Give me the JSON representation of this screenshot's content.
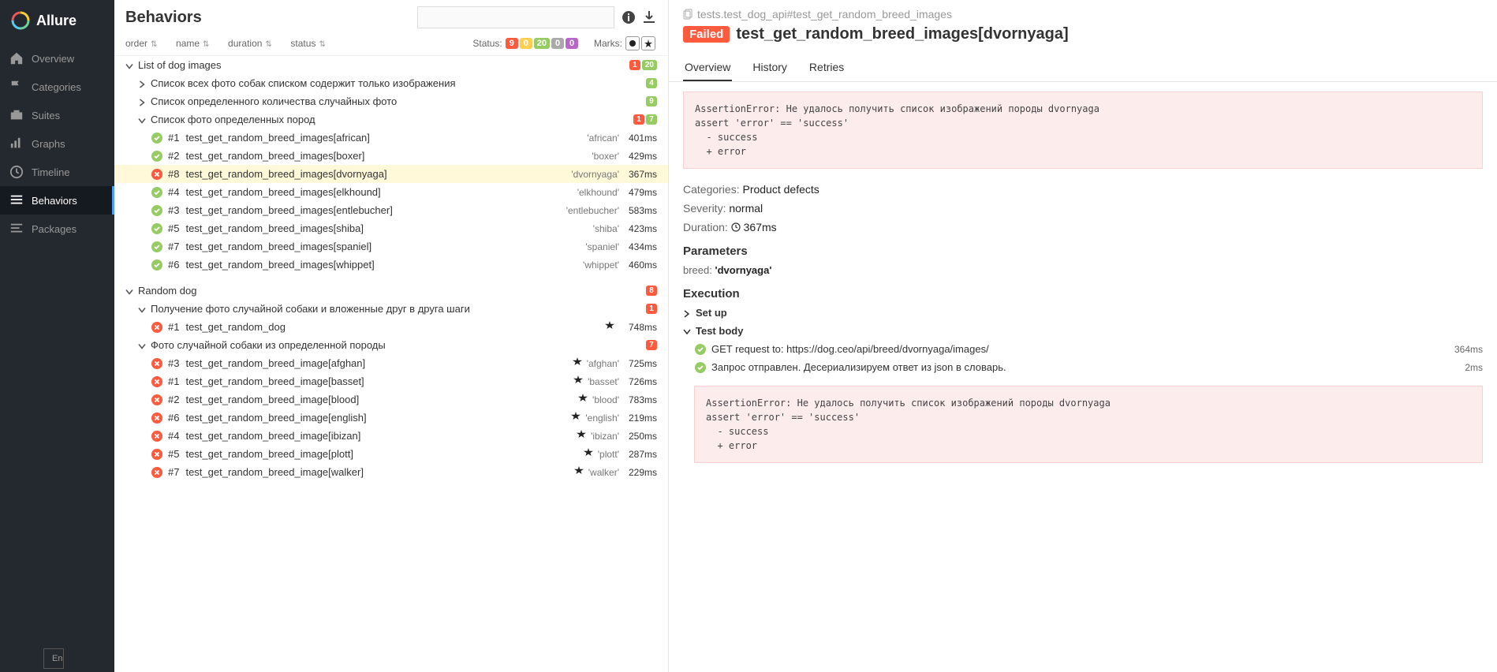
{
  "app": {
    "brand": "Allure"
  },
  "sidebar": {
    "items": [
      {
        "label": "Overview",
        "icon": "home-icon"
      },
      {
        "label": "Categories",
        "icon": "flag-icon"
      },
      {
        "label": "Suites",
        "icon": "briefcase-icon"
      },
      {
        "label": "Graphs",
        "icon": "bars-icon"
      },
      {
        "label": "Timeline",
        "icon": "clock-icon"
      },
      {
        "label": "Behaviors",
        "icon": "list-icon"
      },
      {
        "label": "Packages",
        "icon": "layers-icon"
      }
    ],
    "lang": "En"
  },
  "page": {
    "title": "Behaviors"
  },
  "sorters": {
    "order": "order",
    "name": "name",
    "duration": "duration",
    "status": "status"
  },
  "statusRow": {
    "label": "Status:",
    "counts": {
      "failed": "9",
      "broken": "0",
      "passed": "20",
      "skipped": "0",
      "unknown": "0"
    },
    "marksLabel": "Marks:"
  },
  "tree": {
    "groups": [
      {
        "label": "List of dog images",
        "expanded": true,
        "badges": [
          {
            "cls": "b-red",
            "v": "1"
          },
          {
            "cls": "b-green",
            "v": "20"
          }
        ],
        "stories": [
          {
            "label": "Список всех фото собак списком содержит только изображения",
            "badges": [
              {
                "cls": "b-green",
                "v": "4"
              }
            ],
            "expanded": false
          },
          {
            "label": "Список определенного количества случайных фото",
            "badges": [
              {
                "cls": "b-green",
                "v": "9"
              }
            ],
            "expanded": false
          },
          {
            "label": "Список фото определенных пород",
            "badges": [
              {
                "cls": "b-red",
                "v": "1"
              },
              {
                "cls": "b-green",
                "v": "7"
              }
            ],
            "expanded": true,
            "tests": [
              {
                "status": "passed",
                "num": "#1",
                "name": "test_get_random_breed_images[african]",
                "param": "'african'",
                "dur": "401ms",
                "mark": ""
              },
              {
                "status": "passed",
                "num": "#2",
                "name": "test_get_random_breed_images[boxer]",
                "param": "'boxer'",
                "dur": "429ms",
                "mark": ""
              },
              {
                "status": "failed",
                "num": "#8",
                "name": "test_get_random_breed_images[dvornyaga]",
                "param": "'dvornyaga'",
                "dur": "367ms",
                "mark": "",
                "selected": true
              },
              {
                "status": "passed",
                "num": "#4",
                "name": "test_get_random_breed_images[elkhound]",
                "param": "'elkhound'",
                "dur": "479ms",
                "mark": ""
              },
              {
                "status": "passed",
                "num": "#3",
                "name": "test_get_random_breed_images[entlebucher]",
                "param": "'entlebucher'",
                "dur": "583ms",
                "mark": ""
              },
              {
                "status": "passed",
                "num": "#5",
                "name": "test_get_random_breed_images[shiba]",
                "param": "'shiba'",
                "dur": "423ms",
                "mark": ""
              },
              {
                "status": "passed",
                "num": "#7",
                "name": "test_get_random_breed_images[spaniel]",
                "param": "'spaniel'",
                "dur": "434ms",
                "mark": ""
              },
              {
                "status": "passed",
                "num": "#6",
                "name": "test_get_random_breed_images[whippet]",
                "param": "'whippet'",
                "dur": "460ms",
                "mark": ""
              }
            ]
          }
        ]
      },
      {
        "label": "Random dog",
        "expanded": true,
        "badges": [
          {
            "cls": "b-red",
            "v": "8"
          }
        ],
        "stories": [
          {
            "label": "Получение фото случайной собаки и вложенные друг в друга шаги",
            "badges": [
              {
                "cls": "b-red",
                "v": "1"
              }
            ],
            "expanded": true,
            "tests": [
              {
                "status": "failed",
                "num": "#1",
                "name": "test_get_random_dog",
                "param": "",
                "dur": "748ms",
                "mark": "flaky"
              }
            ]
          },
          {
            "label": "Фото случайной собаки из определенной породы",
            "badges": [
              {
                "cls": "b-red",
                "v": "7"
              }
            ],
            "expanded": true,
            "tests": [
              {
                "status": "failed",
                "num": "#3",
                "name": "test_get_random_breed_image[afghan]",
                "param": "'afghan'",
                "dur": "725ms",
                "mark": "flaky"
              },
              {
                "status": "failed",
                "num": "#1",
                "name": "test_get_random_breed_image[basset]",
                "param": "'basset'",
                "dur": "726ms",
                "mark": "flaky"
              },
              {
                "status": "failed",
                "num": "#2",
                "name": "test_get_random_breed_image[blood]",
                "param": "'blood'",
                "dur": "783ms",
                "mark": "flaky"
              },
              {
                "status": "failed",
                "num": "#6",
                "name": "test_get_random_breed_image[english]",
                "param": "'english'",
                "dur": "219ms",
                "mark": "flaky"
              },
              {
                "status": "failed",
                "num": "#4",
                "name": "test_get_random_breed_image[ibizan]",
                "param": "'ibizan'",
                "dur": "250ms",
                "mark": "flaky"
              },
              {
                "status": "failed",
                "num": "#5",
                "name": "test_get_random_breed_image[plott]",
                "param": "'plott'",
                "dur": "287ms",
                "mark": "flaky"
              },
              {
                "status": "failed",
                "num": "#7",
                "name": "test_get_random_breed_image[walker]",
                "param": "'walker'",
                "dur": "229ms",
                "mark": "flaky"
              }
            ]
          }
        ]
      }
    ]
  },
  "right": {
    "breadcrumb": "tests.test_dog_api#test_get_random_breed_images",
    "status": "Failed",
    "title": "test_get_random_breed_images[dvornyaga]",
    "tabs": {
      "overview": "Overview",
      "history": "History",
      "retries": "Retries"
    },
    "error": "AssertionError: Не удалось получить список изображений породы dvornyaga\nassert 'error' == 'success'\n  - success\n  + error",
    "categories": {
      "label": "Categories:",
      "value": "Product defects"
    },
    "severity": {
      "label": "Severity:",
      "value": "normal"
    },
    "duration": {
      "label": "Duration:",
      "value": "367ms"
    },
    "paramHead": "Parameters",
    "params": {
      "key": "breed:",
      "val": "'dvornyaga'"
    },
    "execHead": "Execution",
    "setup": "Set up",
    "testbody": "Test body",
    "steps": [
      {
        "status": "passed",
        "text": "GET request to: https://dog.ceo/api/breed/dvornyaga/images/",
        "dur": "364ms"
      },
      {
        "status": "passed",
        "text": "Запрос отправлен. Десериализируем ответ из json в словарь.",
        "dur": "2ms"
      }
    ],
    "error2": "AssertionError: Не удалось получить список изображений породы dvornyaga\nassert 'error' == 'success'\n  - success\n  + error"
  }
}
